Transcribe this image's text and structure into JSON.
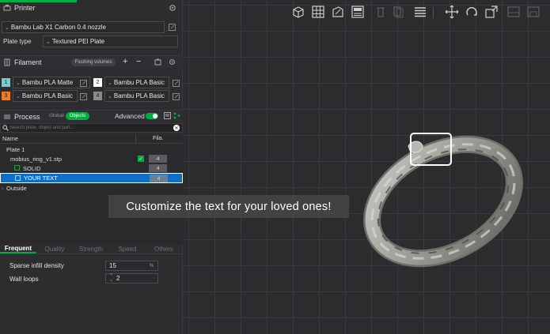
{
  "printer": {
    "title": "Printer",
    "model": "Bambu Lab X1 Carbon 0.4 nozzle",
    "plate_type_label": "Plate type",
    "plate_type_value": "Textured PEI Plate"
  },
  "filament": {
    "title": "Filament",
    "flushing_label": "Flushing volumes",
    "add_symbol": "+",
    "remove_symbol": "−",
    "slots": [
      {
        "num": "1",
        "name": "Bambu PLA Matte",
        "color": "#7ec8cf"
      },
      {
        "num": "2",
        "name": "Bambu PLA Basic",
        "color": "#ffffff"
      },
      {
        "num": "3",
        "name": "Bambu PLA Basic",
        "color": "#f07b21"
      },
      {
        "num": "4",
        "name": "Bambu PLA Basic",
        "color": "#8a8a8a"
      }
    ]
  },
  "process": {
    "title": "Process",
    "global_label": "Global",
    "objects_label": "Objects",
    "advanced_label": "Advanced"
  },
  "search": {
    "placeholder": "Search plate, object and part..."
  },
  "tree": {
    "col_name": "Name",
    "col_fila": "Fila.",
    "plate": "Plate 1",
    "object": "mobius_ring_v1.stp",
    "part_solid": "SOLID",
    "part_text": "YOUR TEXT",
    "outside": "Outside",
    "fil_obj": "4",
    "fil_solid": "4",
    "fil_text": "4"
  },
  "tabs": [
    "Frequent",
    "Quality",
    "Strength",
    "Speed",
    "Others"
  ],
  "params": {
    "infill_label": "Sparse infill density",
    "infill_value": "15",
    "infill_unit": "%",
    "walls_label": "Wall loops",
    "walls_value": "2"
  },
  "caption": "Customize the text for your loved ones!",
  "colors": {
    "accent": "#00ae42",
    "selection": "#0f6fc6",
    "background": "#2b2b2e"
  }
}
